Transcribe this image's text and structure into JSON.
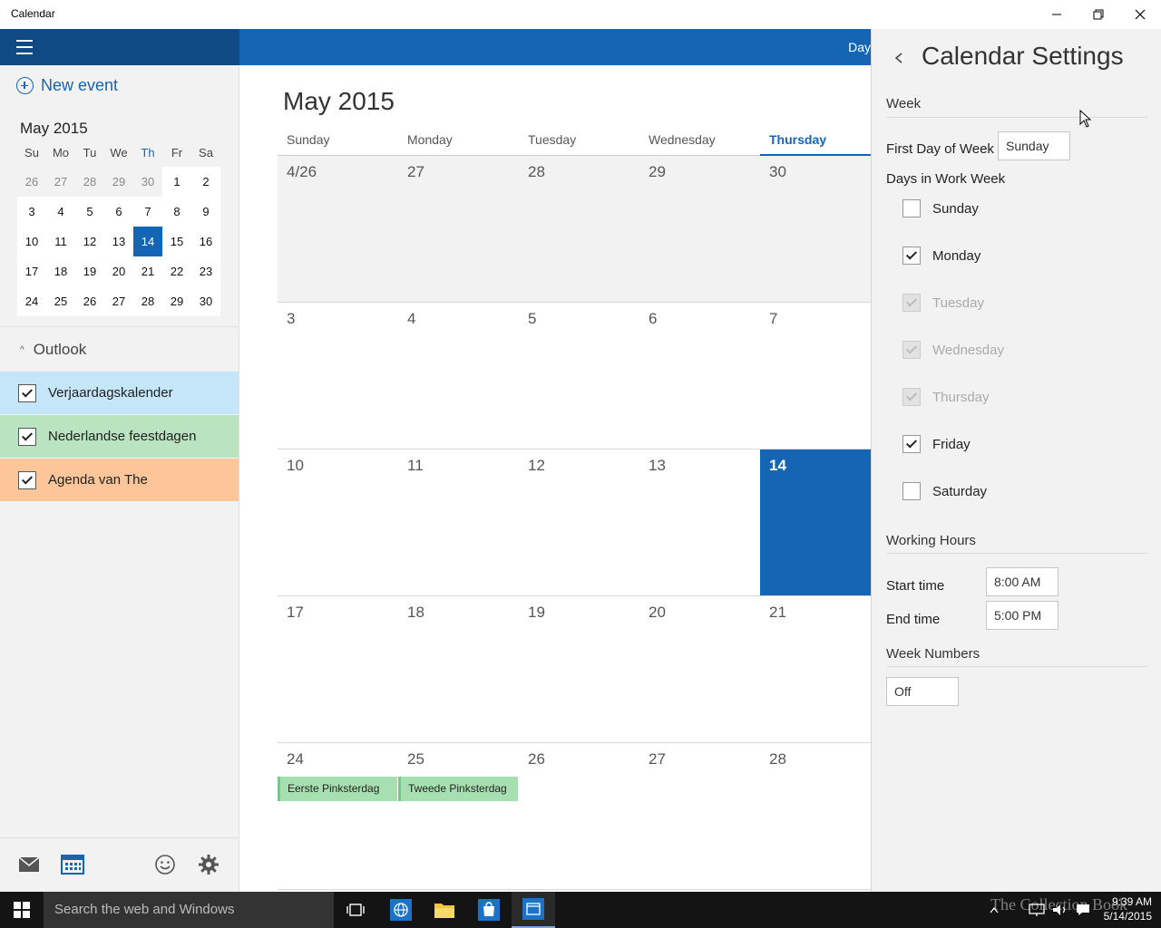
{
  "window": {
    "title": "Calendar"
  },
  "sidebar": {
    "new_event_label": "New event",
    "mini_calendar": {
      "title": "May 2015",
      "weekdays": [
        "Su",
        "Mo",
        "Tu",
        "We",
        "Th",
        "Fr",
        "Sa"
      ],
      "weeks": [
        [
          "26",
          "27",
          "28",
          "29",
          "30",
          "1",
          "2"
        ],
        [
          "3",
          "4",
          "5",
          "6",
          "7",
          "8",
          "9"
        ],
        [
          "10",
          "11",
          "12",
          "13",
          "14",
          "15",
          "16"
        ],
        [
          "17",
          "18",
          "19",
          "20",
          "21",
          "22",
          "23"
        ],
        [
          "24",
          "25",
          "26",
          "27",
          "28",
          "29",
          "30"
        ]
      ],
      "selected": "14"
    },
    "account_header": "Outlook",
    "calendars": [
      {
        "name": "Verjaardagskalender",
        "checked": true,
        "color": "#c4e6f8"
      },
      {
        "name": "Nederlandse feestdagen",
        "checked": true,
        "color": "#b9e4bf"
      },
      {
        "name": "Agenda van The",
        "checked": true,
        "color": "#fcc69a"
      }
    ],
    "bottom_icons": [
      "mail-icon",
      "calendar-icon",
      "smiley-icon",
      "gear-icon"
    ]
  },
  "main": {
    "view_label": "Day",
    "month_title": "May 2015",
    "weekdays": [
      "Sunday",
      "Monday",
      "Tuesday",
      "Wednesday",
      "Thursday"
    ],
    "today_weekday": "Thursday",
    "weeks": [
      [
        "4/26",
        "27",
        "28",
        "29",
        "30"
      ],
      [
        "3",
        "4",
        "5",
        "6",
        "7"
      ],
      [
        "10",
        "11",
        "12",
        "13",
        "14"
      ],
      [
        "17",
        "18",
        "19",
        "20",
        "21"
      ],
      [
        "24",
        "25",
        "26",
        "27",
        "28"
      ]
    ],
    "today": "14",
    "events": [
      {
        "day": "24",
        "title": "Eerste Pinksterdag"
      },
      {
        "day": "25",
        "title": "Tweede Pinksterdag"
      }
    ],
    "accent_color": "#1565b5"
  },
  "settings": {
    "title": "Calendar Settings",
    "week_section": "Week",
    "first_day_label": "First Day of Week",
    "first_day_value": "Sunday",
    "work_week_label": "Days in Work Week",
    "days": [
      {
        "name": "Sunday",
        "checked": false,
        "disabled": false
      },
      {
        "name": "Monday",
        "checked": true,
        "disabled": false
      },
      {
        "name": "Tuesday",
        "checked": true,
        "disabled": true
      },
      {
        "name": "Wednesday",
        "checked": true,
        "disabled": true
      },
      {
        "name": "Thursday",
        "checked": true,
        "disabled": true
      },
      {
        "name": "Friday",
        "checked": true,
        "disabled": false
      },
      {
        "name": "Saturday",
        "checked": false,
        "disabled": false
      }
    ],
    "working_hours_section": "Working Hours",
    "start_time_label": "Start time",
    "start_time_value": "8:00 AM",
    "end_time_label": "End time",
    "end_time_value": "5:00 PM",
    "week_numbers_section": "Week Numbers",
    "week_numbers_value": "Off"
  },
  "taskbar": {
    "search_placeholder": "Search the web and Windows",
    "time": "9:39 AM",
    "date": "5/14/2015",
    "watermark": "The Collection Book"
  }
}
